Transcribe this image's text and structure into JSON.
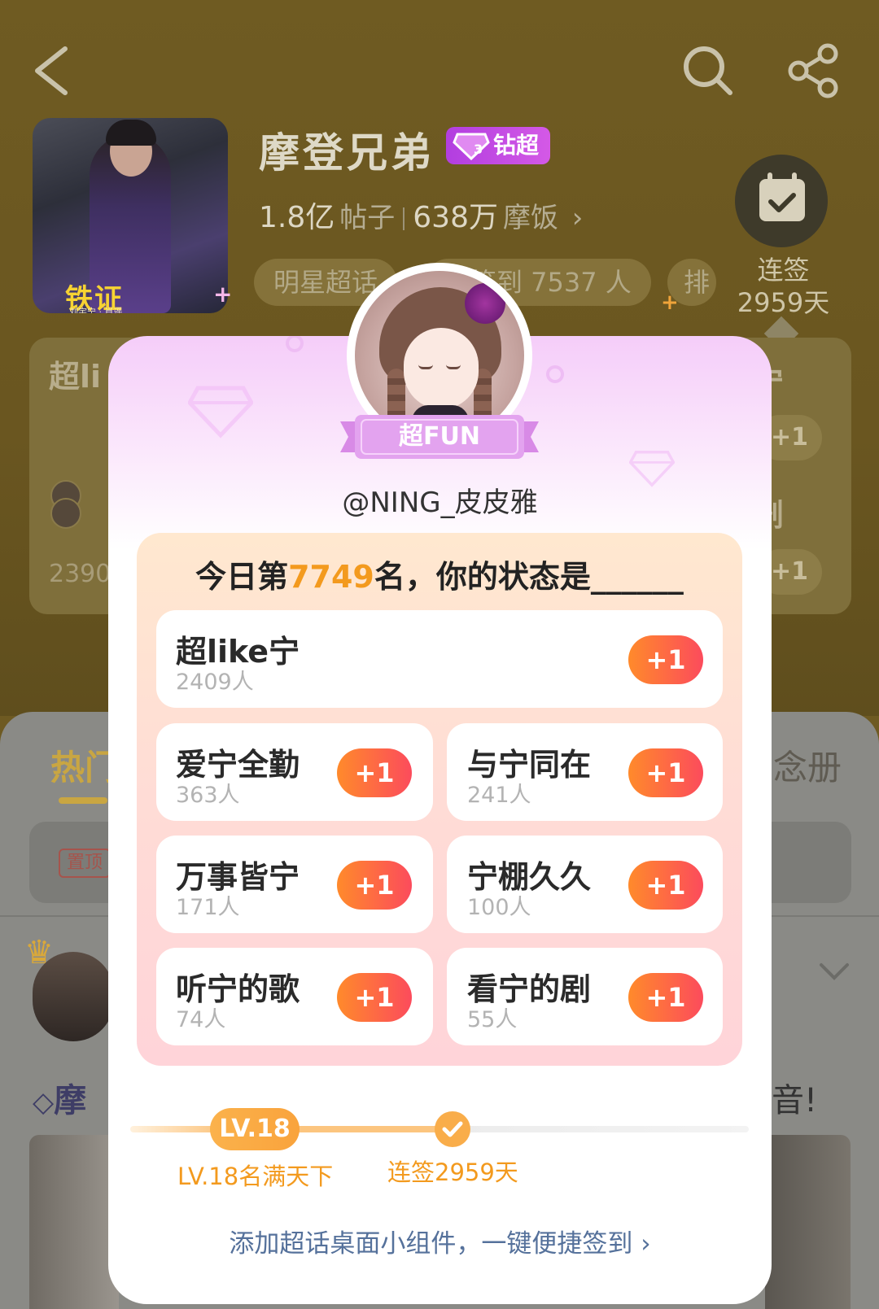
{
  "header": {
    "back_icon": "chevron-left-icon",
    "search_icon": "search-icon",
    "share_icon": "share-icon"
  },
  "topic": {
    "cover_logo": "铁证",
    "cover_sub": "刘宇宁 · 肖遥",
    "name": "摩登兄弟",
    "badge": "钻超",
    "posts_count": "1.8亿",
    "posts_label": "帖子",
    "fans_count": "638万",
    "fans_label": "摩饭",
    "chips": [
      "明星超话",
      "已签到 7537 人",
      "排"
    ],
    "checkin_label": "连签",
    "checkin_days": "2959天"
  },
  "background": {
    "card_title_left": "超li",
    "card_title_right": "宁",
    "card_row2_right": "剧",
    "card_num_left": "2390",
    "plus_label": "+1",
    "tab_active": "热门",
    "tab_right": "念册",
    "pinned_tag": "置顶",
    "post_title": "摩",
    "post_title_end": "音!"
  },
  "modal": {
    "level_badge": "超FUN",
    "username": "@NING_皮皮雅",
    "rank_prefix": "今日第",
    "rank_number": "7749",
    "rank_suffix": "名，你的状态是______",
    "options": [
      {
        "label": "超like宁",
        "count": "2409人",
        "button": "+1"
      },
      {
        "label": "爱宁全勤",
        "count": "363人",
        "button": "+1"
      },
      {
        "label": "与宁同在",
        "count": "241人",
        "button": "+1"
      },
      {
        "label": "万事皆宁",
        "count": "171人",
        "button": "+1"
      },
      {
        "label": "宁棚久久",
        "count": "100人",
        "button": "+1"
      },
      {
        "label": "听宁的歌",
        "count": "74人",
        "button": "+1"
      },
      {
        "label": "看宁的剧",
        "count": "55人",
        "button": "+1"
      }
    ],
    "level_pill": "LV.18",
    "level_caption": "LV.18名满天下",
    "streak_caption": "连签2959天",
    "widget_link": "添加超话桌面小组件，一键便捷签到 ›"
  },
  "colors": {
    "accent_orange": "#f39a1e",
    "plus_gradient_start": "#ff8a2b",
    "plus_gradient_end": "#fc4b5c",
    "badge_purple": "#b23ee0",
    "link_blue": "#55719b"
  }
}
